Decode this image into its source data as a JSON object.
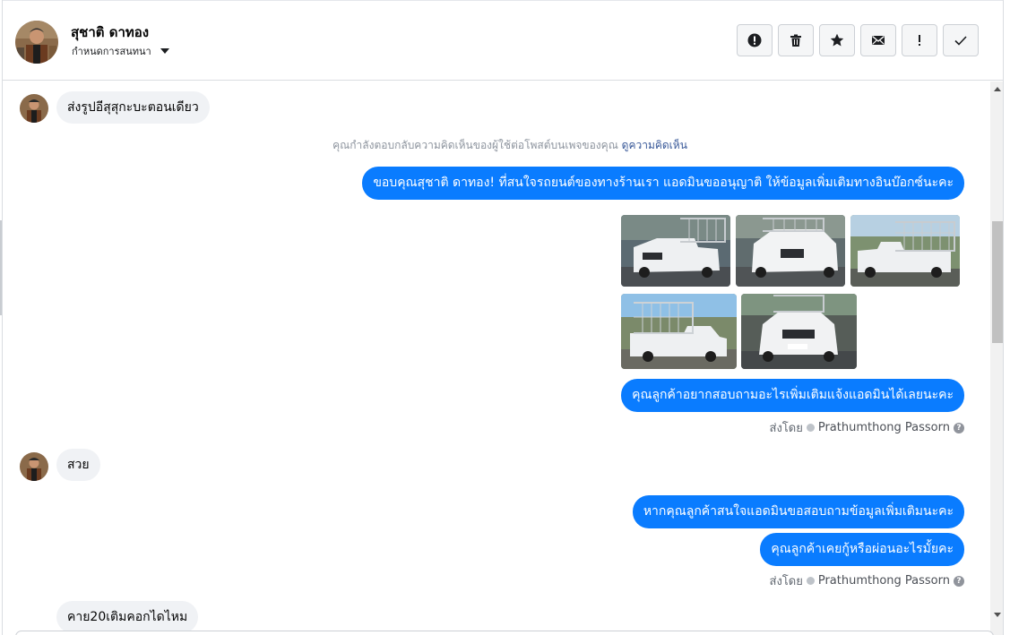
{
  "header": {
    "contact_name": "สุชาติ ดาทอง",
    "assign_label": "กำหนดการสนทนา",
    "actions": [
      {
        "name": "spam-report-button",
        "icon": "alert-circle-icon"
      },
      {
        "name": "delete-button",
        "icon": "trash-icon"
      },
      {
        "name": "star-button",
        "icon": "star-icon"
      },
      {
        "name": "mark-unread-button",
        "icon": "envelope-icon"
      },
      {
        "name": "follow-up-button",
        "icon": "exclamation-icon"
      },
      {
        "name": "mark-done-button",
        "icon": "checkmark-icon"
      }
    ]
  },
  "messages": {
    "m1": "ส่งรูปอีสุสุกะบะตอนเดียว",
    "notice_text": "คุณกำลังตอบกลับความคิดเห็นของผู้ใช้ต่อโพสต์บนเพจของคุณ",
    "notice_link": "ดูความคิดเห็น",
    "m2": "ขอบคุณสุชาติ ดาทอง! ที่สนใจรถยนต์ของทางร้านเรา แอดมินขออนุญาติ ให้ข้อมูลเพิ่มเติมทางอินบ๊อกซ์นะคะ",
    "m3": "คุณลูกค้าอยากสอบถามอะไรเพิ่มเติมแจ้งแอดมินได้เลยนะคะ",
    "sent_by_1": "ส่งโดย",
    "agent_1": "Prathumthong Passorn",
    "m4": "สวย",
    "m5": "หากคุณลูกค้าสนใจแอดมินขอสอบถามข้อมูลเพิ่มเติมนะคะ",
    "m6": "คุณลูกค้าเคยกู้หรือผ่อนอะไรมั้ยคะ",
    "sent_by_2": "ส่งโดย",
    "agent_2": "Prathumthong Passorn",
    "m7": "คาย20เติมคอกไดไหม"
  },
  "colors": {
    "outgoing_bubble": "#0a7cff",
    "incoming_bubble": "#f0f2f5",
    "link": "#385898"
  }
}
